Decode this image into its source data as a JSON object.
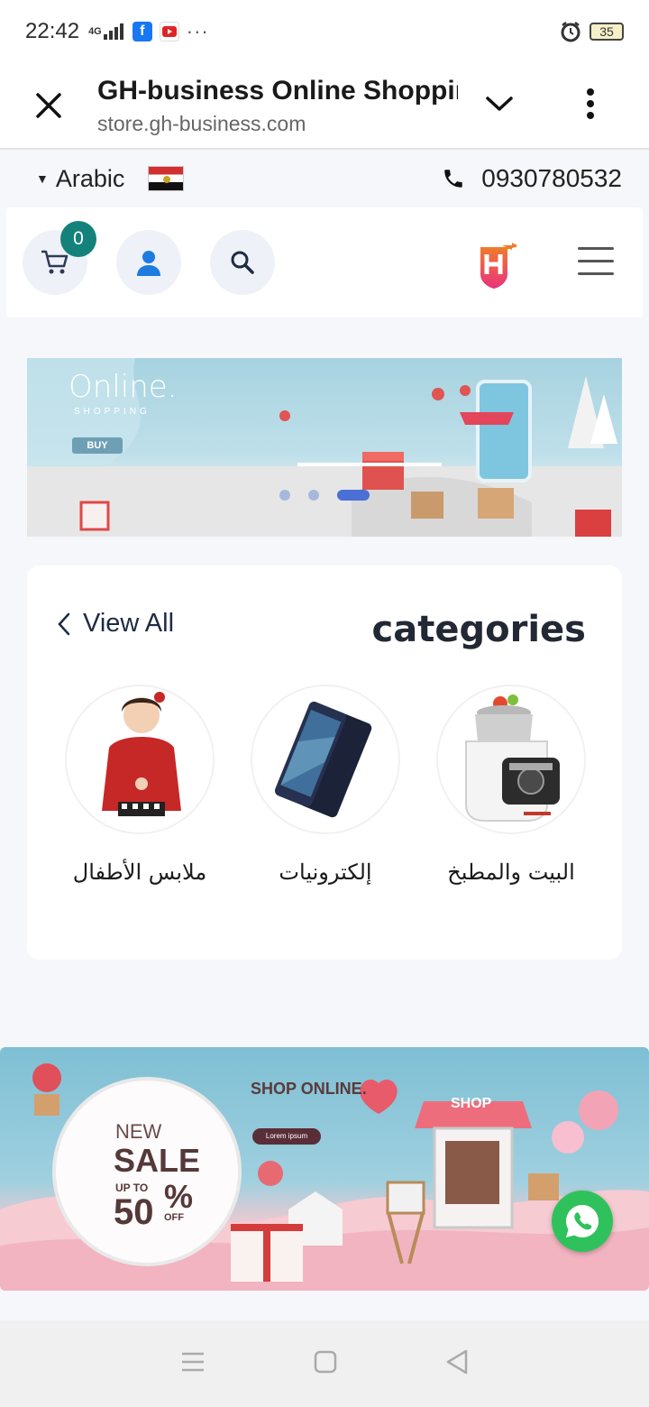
{
  "status_bar": {
    "time": "22:42",
    "network": "4G",
    "battery": "35",
    "more": "···"
  },
  "browser": {
    "title": "GH-business Online Shopping",
    "url": "store.gh-business.com"
  },
  "top_bar": {
    "language": "Arabic",
    "phone": "0930780532"
  },
  "nav": {
    "cart_count": "0"
  },
  "hero": {
    "headline": "Online.",
    "subline": "SHOPPING",
    "button": "BUY",
    "slides_total": 3,
    "active_slide": 3
  },
  "categories": {
    "title": "categories",
    "view_all": "View All",
    "items": [
      {
        "label": "ملابس الأطفال",
        "icon": "kids-clothes-image"
      },
      {
        "label": "إلكترونيات",
        "icon": "smartphone-image"
      },
      {
        "label": "البيت والمطبخ",
        "icon": "kitchen-machine-image"
      }
    ]
  },
  "sale_banner": {
    "new": "NEW",
    "sale": "SALE",
    "up_to": "UP TO",
    "percent": "50",
    "percent_sign": "%",
    "off": "OFF",
    "shop_online": "SHOP ONLINE.",
    "lorem": "Lorem ipsum",
    "shop_sign": "SHOP"
  },
  "colors": {
    "accent_badge": "#14827a",
    "user_icon": "#1e7be0",
    "slider_active": "#4a6fd6",
    "whatsapp": "#2fc25c"
  }
}
